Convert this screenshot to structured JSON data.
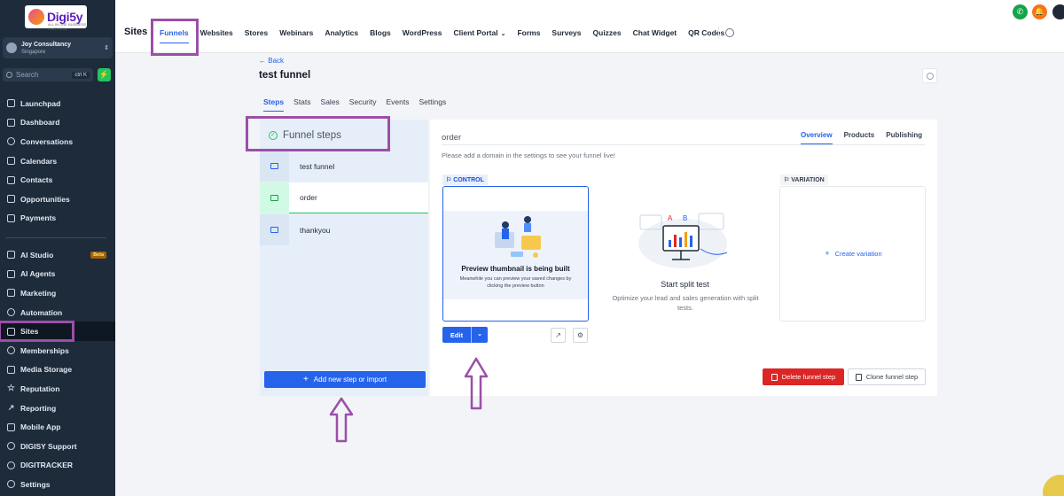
{
  "brand": {
    "name": "Digi5y",
    "tagline": "ALL IN ONE BUSINESS PLATFORM"
  },
  "account": {
    "name": "Joy Consultancy",
    "location": "Singapore"
  },
  "search": {
    "placeholder": "Search",
    "shortcut": "ctrl K"
  },
  "sidebar": {
    "group1": [
      {
        "label": "Launchpad",
        "icon": "rocket-icon"
      },
      {
        "label": "Dashboard",
        "icon": "grid-icon"
      },
      {
        "label": "Conversations",
        "icon": "chat-icon"
      },
      {
        "label": "Calendars",
        "icon": "calendar-icon"
      },
      {
        "label": "Contacts",
        "icon": "contacts-icon"
      },
      {
        "label": "Opportunities",
        "icon": "funnel-icon"
      },
      {
        "label": "Payments",
        "icon": "receipt-icon"
      }
    ],
    "group2": [
      {
        "label": "AI Studio",
        "icon": "sparkle-icon",
        "badge": "Beta"
      },
      {
        "label": "AI Agents",
        "icon": "agent-icon"
      },
      {
        "label": "Marketing",
        "icon": "send-icon"
      },
      {
        "label": "Automation",
        "icon": "automation-icon"
      },
      {
        "label": "Sites",
        "icon": "sites-icon",
        "active": true
      },
      {
        "label": "Memberships",
        "icon": "membership-icon"
      },
      {
        "label": "Media Storage",
        "icon": "media-icon"
      },
      {
        "label": "Reputation",
        "icon": "star-icon"
      },
      {
        "label": "Reporting",
        "icon": "chart-icon"
      },
      {
        "label": "Mobile App",
        "icon": "mobile-icon"
      },
      {
        "label": "DIGISY Support",
        "icon": "support-icon"
      },
      {
        "label": "DIGITRACKER",
        "icon": "tracker-icon"
      },
      {
        "label": "Settings",
        "icon": "gear-icon"
      }
    ]
  },
  "topbar": {
    "section_title": "Sites",
    "tabs": [
      "Funnels",
      "Websites",
      "Stores",
      "Webinars",
      "Analytics",
      "Blogs",
      "WordPress",
      "Client Portal",
      "Forms",
      "Surveys",
      "Quizzes",
      "Chat Widget",
      "QR Codes"
    ],
    "active_tab": "Funnels"
  },
  "page": {
    "back_label": "Back",
    "title": "test funnel",
    "tabs": [
      "Steps",
      "Stats",
      "Sales",
      "Security",
      "Events",
      "Settings"
    ],
    "active_tab": "Steps"
  },
  "steps_panel": {
    "header": "Funnel steps",
    "steps": [
      "test funnel",
      "order",
      "thankyou"
    ],
    "selected_step": "order",
    "add_button": "Add new step or import"
  },
  "detail": {
    "step_name": "order",
    "tabs": [
      "Overview",
      "Products",
      "Publishing"
    ],
    "active_tab": "Overview",
    "domain_note": "Please add a domain in the settings to see your funnel live!",
    "control_label": "CONTROL",
    "variation_label": "VARIATION",
    "preview_title": "Preview thumbnail is being built",
    "preview_subtitle": "Meanwhile you can preview your saved changes by clicking the preview button",
    "edit_button": "Edit",
    "split_title": "Start split test",
    "split_subtitle": "Optimize your lead and sales generation with split tests.",
    "create_variation": "Create variation",
    "delete_button": "Delete funnel step",
    "clone_button": "Clone funnel step"
  },
  "colors": {
    "sidebar_bg": "#1e2b3b",
    "accent": "#2563eb",
    "success": "#22c55e",
    "danger": "#dc2626",
    "annotation": "#9b4fa8"
  }
}
